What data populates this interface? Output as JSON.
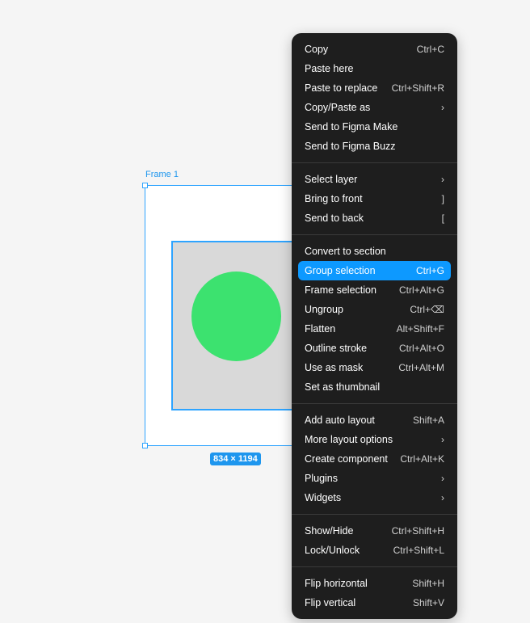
{
  "canvas": {
    "frame_label": "Frame 1",
    "dimensions_badge": "834 × 1194",
    "colors": {
      "selection": "#0d99ff",
      "circle_fill": "#3ce26f",
      "rect_fill": "#d9d9d9"
    }
  },
  "context_menu": {
    "groups": [
      [
        {
          "label": "Copy",
          "shortcut": "Ctrl+C"
        },
        {
          "label": "Paste here",
          "shortcut": ""
        },
        {
          "label": "Paste to replace",
          "shortcut": "Ctrl+Shift+R"
        },
        {
          "label": "Copy/Paste as",
          "submenu": true
        },
        {
          "label": "Send to Figma Make",
          "shortcut": ""
        },
        {
          "label": "Send to Figma Buzz",
          "shortcut": ""
        }
      ],
      [
        {
          "label": "Select layer",
          "submenu": true
        },
        {
          "label": "Bring to front",
          "shortcut": "]"
        },
        {
          "label": "Send to back",
          "shortcut": "["
        }
      ],
      [
        {
          "label": "Convert to section",
          "shortcut": ""
        },
        {
          "label": "Group selection",
          "shortcut": "Ctrl+G",
          "active": true
        },
        {
          "label": "Frame selection",
          "shortcut": "Ctrl+Alt+G"
        },
        {
          "label": "Ungroup",
          "shortcut": "Ctrl+⌫"
        },
        {
          "label": "Flatten",
          "shortcut": "Alt+Shift+F"
        },
        {
          "label": "Outline stroke",
          "shortcut": "Ctrl+Alt+O"
        },
        {
          "label": "Use as mask",
          "shortcut": "Ctrl+Alt+M"
        },
        {
          "label": "Set as thumbnail",
          "shortcut": ""
        }
      ],
      [
        {
          "label": "Add auto layout",
          "shortcut": "Shift+A"
        },
        {
          "label": "More layout options",
          "submenu": true
        },
        {
          "label": "Create component",
          "shortcut": "Ctrl+Alt+K"
        },
        {
          "label": "Plugins",
          "submenu": true
        },
        {
          "label": "Widgets",
          "submenu": true
        }
      ],
      [
        {
          "label": "Show/Hide",
          "shortcut": "Ctrl+Shift+H"
        },
        {
          "label": "Lock/Unlock",
          "shortcut": "Ctrl+Shift+L"
        }
      ],
      [
        {
          "label": "Flip horizontal",
          "shortcut": "Shift+H"
        },
        {
          "label": "Flip vertical",
          "shortcut": "Shift+V"
        }
      ]
    ]
  }
}
